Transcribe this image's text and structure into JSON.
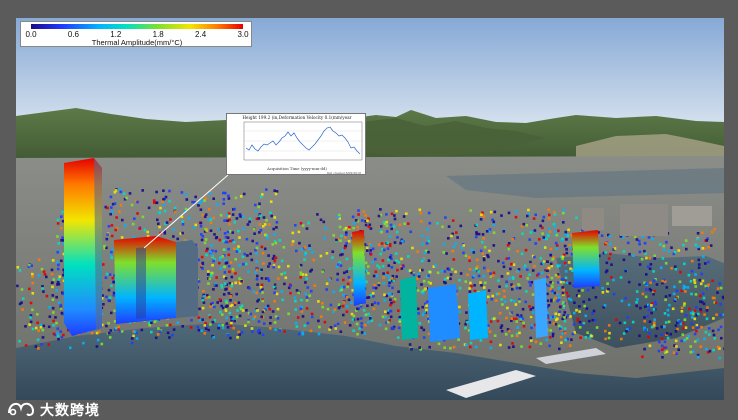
{
  "legend": {
    "title": "Thermal Amplitude(mm/°C)",
    "ticks": [
      "0.0",
      "0.6",
      "1.2",
      "1.8",
      "2.4",
      "3.0"
    ],
    "colors": [
      "#1a0a8c",
      "#1f3cff",
      "#00b4ff",
      "#00e0c0",
      "#7fe02a",
      "#f2e600",
      "#ff7a00",
      "#e60000"
    ]
  },
  "inset_chart": {
    "title": "Height 199.2 (in,Deformation Velocity 0.1(mm/year",
    "xlabel": "Acquisition Time (yyyy-mm-dd)",
    "note": "Dat created 8/09/2018"
  },
  "watermark": {
    "text": "大数跨境",
    "logo": "logo-icon"
  },
  "colors": {
    "sky_top": "#8fb1d9",
    "sky_bottom": "#cfdcec",
    "mountain": "#4e6b3c",
    "water": "#3e5566",
    "city": "#7d7f7a"
  }
}
